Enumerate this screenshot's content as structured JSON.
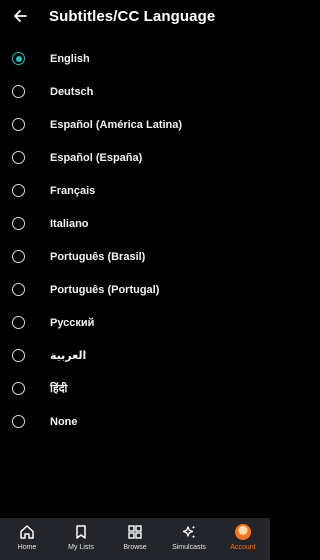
{
  "header": {
    "title": "Subtitles/CC Language"
  },
  "options": [
    {
      "label": "English",
      "selected": true
    },
    {
      "label": "Deutsch",
      "selected": false
    },
    {
      "label": "Español (América Latina)",
      "selected": false
    },
    {
      "label": "Español (España)",
      "selected": false
    },
    {
      "label": "Français",
      "selected": false
    },
    {
      "label": "Italiano",
      "selected": false
    },
    {
      "label": "Português (Brasil)",
      "selected": false
    },
    {
      "label": "Português (Portugal)",
      "selected": false
    },
    {
      "label": "Русский",
      "selected": false
    },
    {
      "label": "العربية",
      "selected": false
    },
    {
      "label": "हिंदी",
      "selected": false
    },
    {
      "label": "None",
      "selected": false
    }
  ],
  "tabbar": {
    "tabs": [
      {
        "label": "Home",
        "icon": "home-icon"
      },
      {
        "label": "My Lists",
        "icon": "bookmark-icon"
      },
      {
        "label": "Browse",
        "icon": "grid-icon"
      },
      {
        "label": "Simulcasts",
        "icon": "sparkle-icon"
      },
      {
        "label": "Account",
        "icon": "avatar-icon",
        "active": true
      }
    ]
  },
  "colors": {
    "accent": "#2abdbb",
    "active_tab": "#f47521",
    "tabbar_bg": "#23252b"
  }
}
